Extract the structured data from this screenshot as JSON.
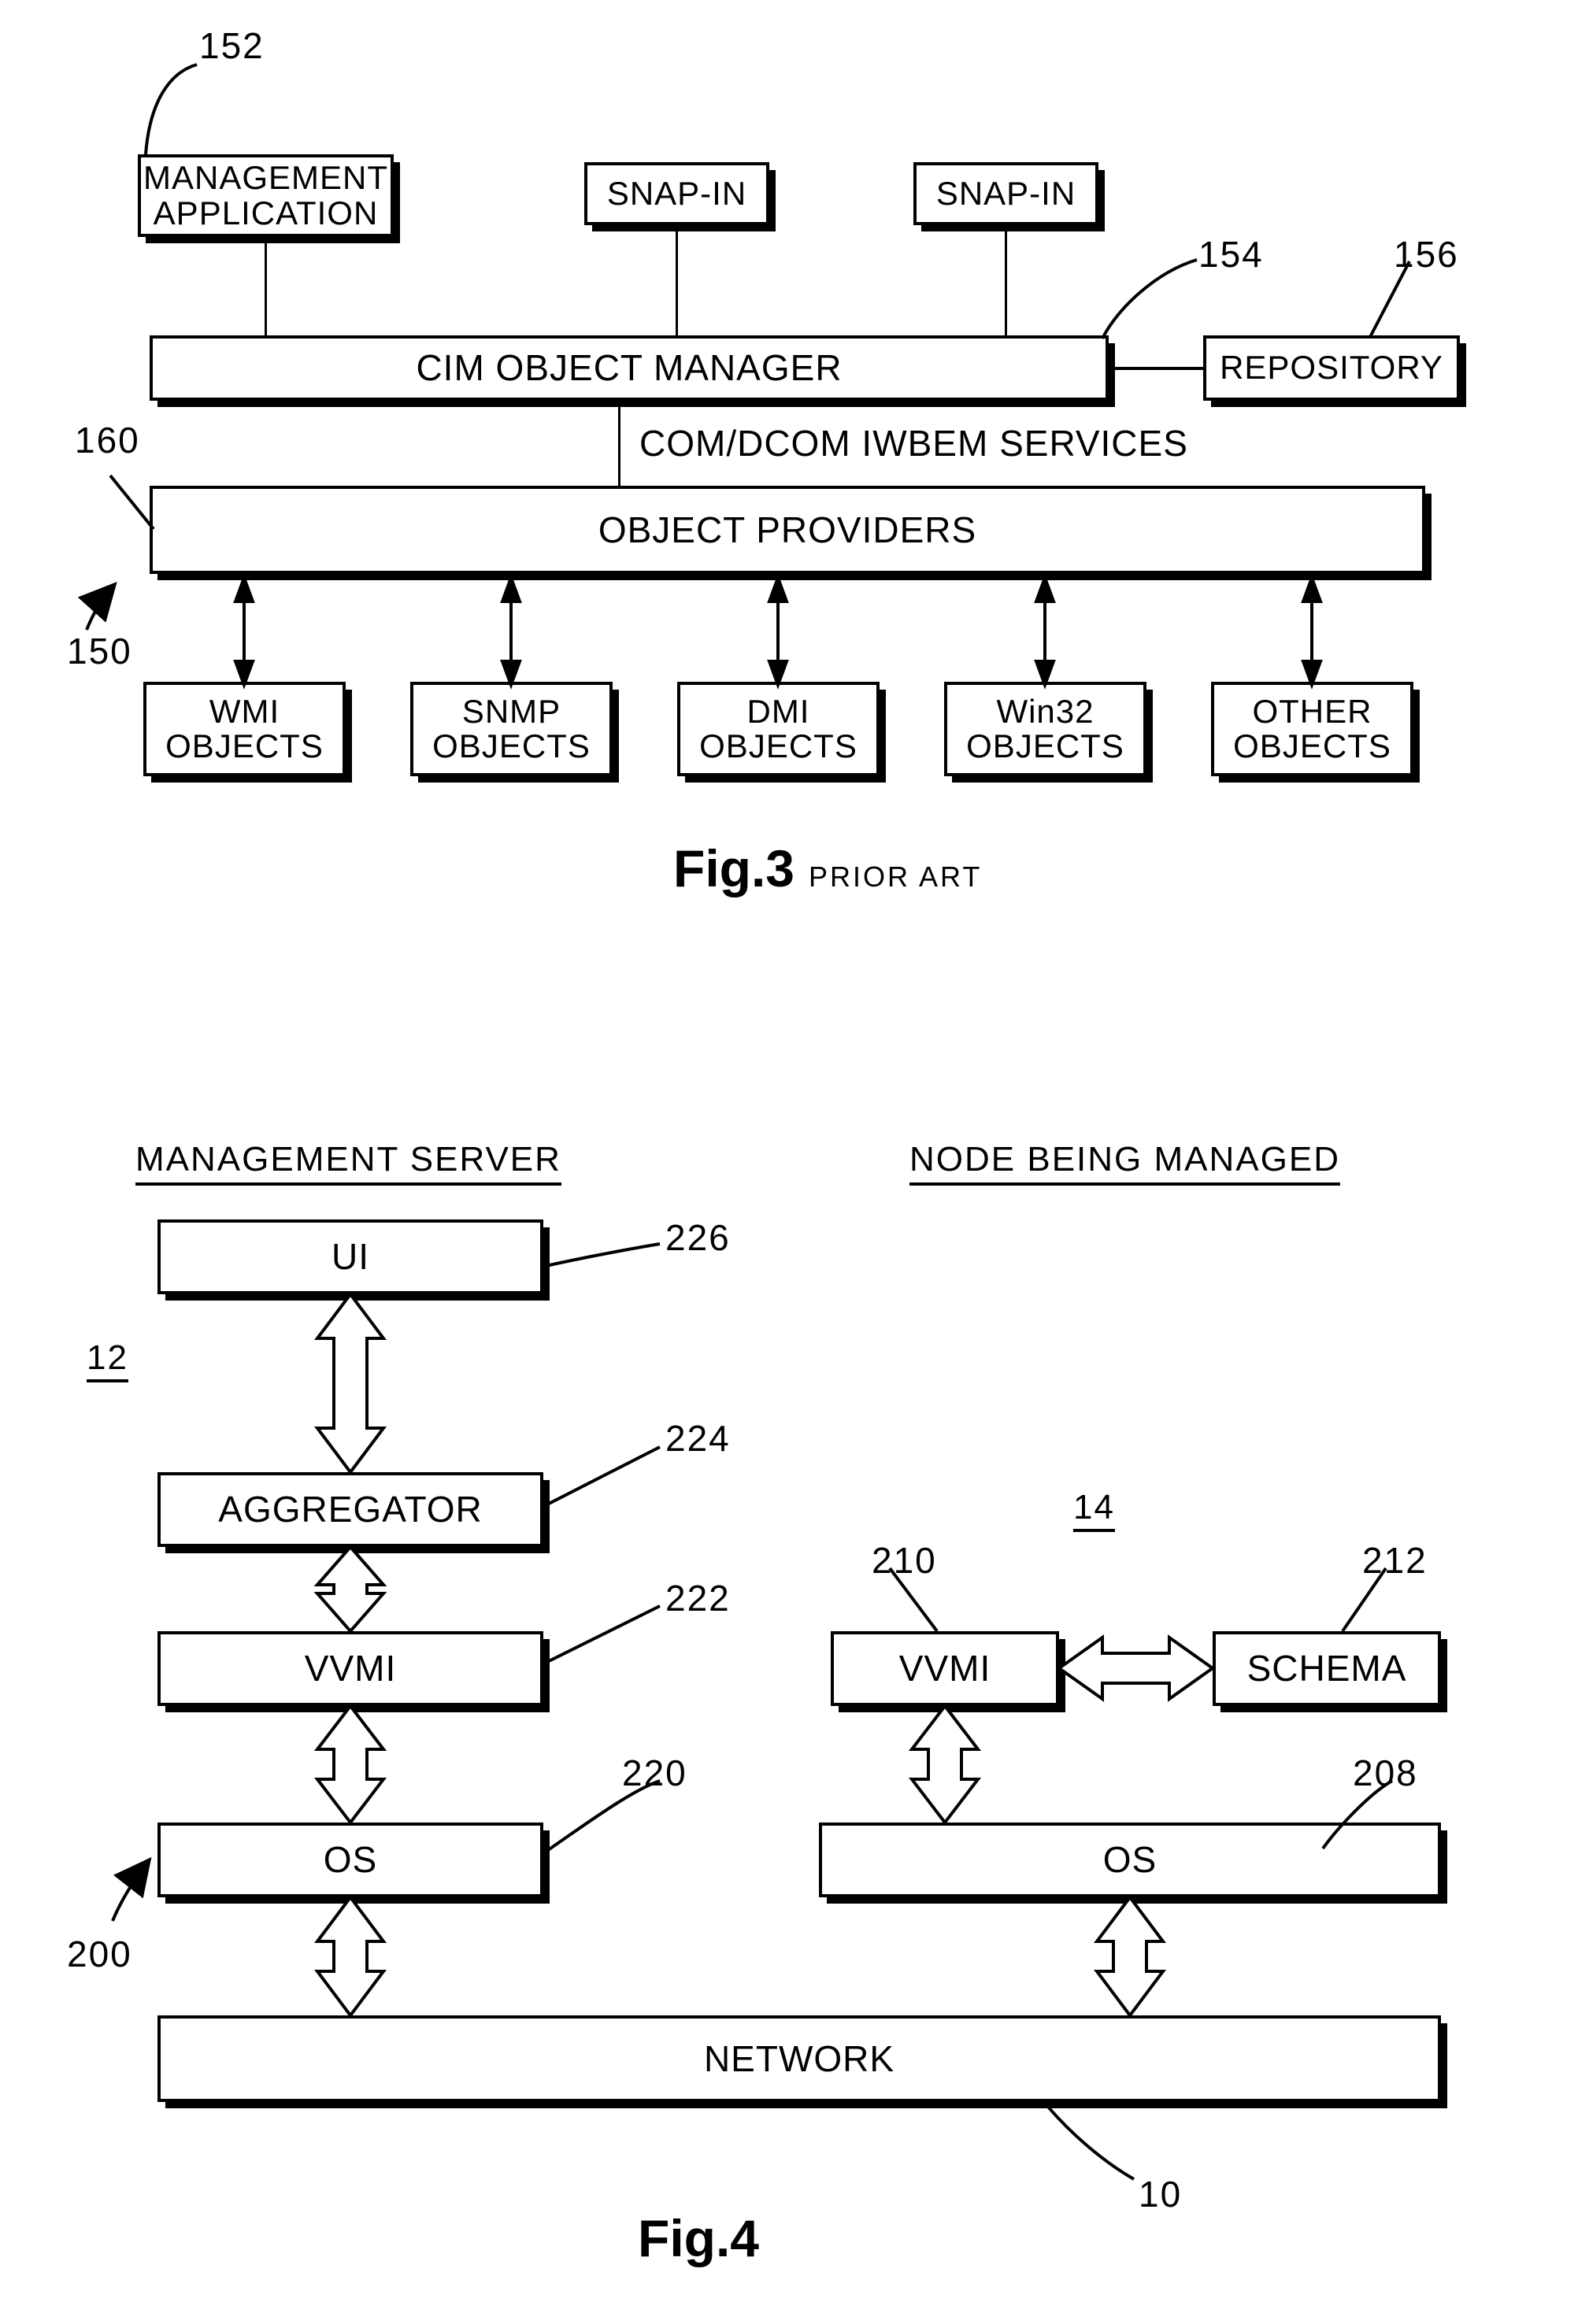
{
  "figure3": {
    "caption": "Fig.3",
    "caption_note": "PRIOR ART",
    "boxes": {
      "management_application": "MANAGEMENT\nAPPLICATION",
      "snap_in_1": "SNAP-IN",
      "snap_in_2": "SNAP-IN",
      "cim_object_manager": "CIM OBJECT MANAGER",
      "repository": "REPOSITORY",
      "object_providers": "OBJECT PROVIDERS",
      "wmi_objects": "WMI\nOBJECTS",
      "snmp_objects": "SNMP\nOBJECTS",
      "dmi_objects": "DMI\nOBJECTS",
      "win32_objects": "Win32\nOBJECTS",
      "other_objects": "OTHER\nOBJECTS"
    },
    "labels": {
      "services": "COM/DCOM IWBEM SERVICES"
    },
    "refs": {
      "r152": "152",
      "r154": "154",
      "r156": "156",
      "r160": "160",
      "r150": "150"
    }
  },
  "figure4": {
    "caption": "Fig.4",
    "headers": {
      "left": "MANAGEMENT SERVER",
      "right": "NODE BEING MANAGED"
    },
    "boxes": {
      "ui": "UI",
      "aggregator": "AGGREGATOR",
      "vvmi_server": "VVMI",
      "os_server": "OS",
      "vvmi_node": "VVMI",
      "schema": "SCHEMA",
      "os_node": "OS",
      "network": "NETWORK"
    },
    "refs": {
      "r226": "226",
      "r224": "224",
      "r222": "222",
      "r220": "220",
      "r210": "210",
      "r212": "212",
      "r208": "208",
      "r200": "200",
      "r12": "12",
      "r14": "14",
      "r10": "10"
    }
  }
}
